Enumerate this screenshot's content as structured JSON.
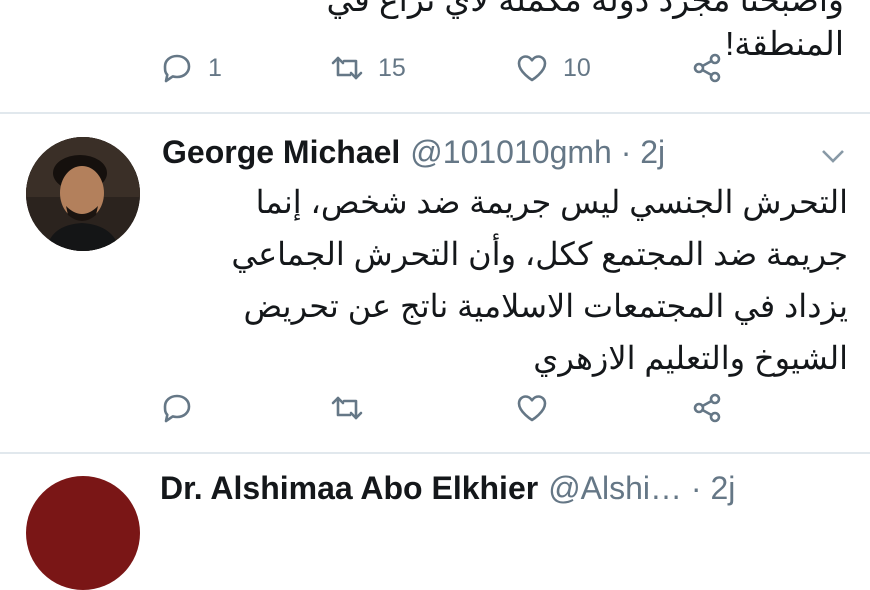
{
  "tweet1": {
    "text_tail": "وأصبحنا مجرد دولة مكملة لأي نزاع في المنطقة!",
    "replies": "1",
    "retweets": "15",
    "likes": "10"
  },
  "tweet2": {
    "name": "George Michael",
    "handle": "@101010gmh · 2j",
    "text_lines": [
      "التحرش الجنسي ليس جريمة ضد شخص، إنما",
      "جريمة ضد المجتمع ككل، وأن التحرش الجماعي",
      "يزداد في المجتمعات الاسلامية ناتج عن تحريض",
      "الشيوخ والتعليم الازهري"
    ],
    "replies": "",
    "retweets": "",
    "likes": ""
  },
  "tweet3": {
    "name": "Dr. Alshimaa Abo Elkhier",
    "handle": "@Alshi… · 2j"
  },
  "icons": {
    "reply": "reply-icon",
    "retweet": "retweet-icon",
    "like": "heart-icon",
    "share": "share-icon",
    "menu": "chevron-down-icon"
  },
  "colors": {
    "text": "#14171a",
    "muted": "#657786",
    "divider": "#e1e8ed"
  }
}
